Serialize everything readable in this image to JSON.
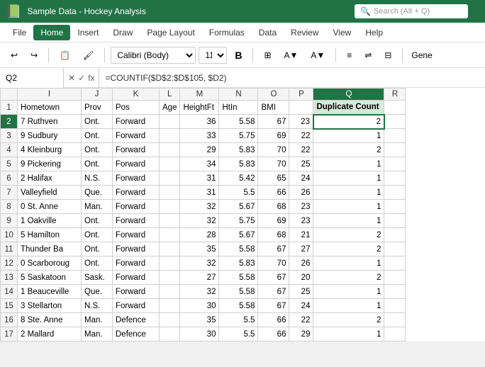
{
  "titleBar": {
    "icon": "📗",
    "title": "Sample Data - Hockey Analysis",
    "searchPlaceholder": "Search (Alt + Q)"
  },
  "menuBar": {
    "items": [
      "File",
      "Home",
      "Insert",
      "Draw",
      "Page Layout",
      "Formulas",
      "Data",
      "Review",
      "View",
      "Help"
    ],
    "activeIndex": 1
  },
  "toolbar": {
    "font": "Calibri (Body)",
    "fontSize": "11",
    "boldLabel": "B"
  },
  "formulaBar": {
    "nameBox": "Q2",
    "formula": "=COUNTIF($D$2:$D$105, $D2)"
  },
  "columns": {
    "headers": [
      "I",
      "J",
      "K",
      "L",
      "M",
      "N",
      "O",
      "P",
      "Q",
      "R"
    ],
    "widths": [
      90,
      50,
      70,
      30,
      60,
      60,
      50,
      40,
      90,
      30
    ]
  },
  "rowHeaders": [
    1,
    2,
    3,
    4,
    5,
    6,
    7,
    8,
    9,
    10,
    11,
    12,
    13,
    14,
    15,
    16,
    17
  ],
  "headerRow": {
    "cells": [
      "Hometown",
      "Prov",
      "Pos",
      "Age",
      "HeightFt",
      "HtIn",
      "BMI",
      "",
      "Duplicate Count",
      ""
    ]
  },
  "rows": [
    {
      "num": 2,
      "i": "7 Ruthven",
      "j": "Ont.",
      "k": "Forward",
      "l": "",
      "m": "36",
      "n": "5.58",
      "o": "67",
      "p": "23",
      "q": "2",
      "selected": true
    },
    {
      "num": 3,
      "i": "9 Sudbury",
      "j": "Ont.",
      "k": "Forward",
      "l": "",
      "m": "33",
      "n": "5.75",
      "o": "69",
      "p": "22",
      "q": "1",
      "selected": false
    },
    {
      "num": 4,
      "i": "4 Kleinburg",
      "j": "Ont.",
      "k": "Forward",
      "l": "",
      "m": "29",
      "n": "5.83",
      "o": "70",
      "p": "22",
      "q": "2",
      "selected": false
    },
    {
      "num": 5,
      "i": "9 Pickering",
      "j": "Ont.",
      "k": "Forward",
      "l": "",
      "m": "34",
      "n": "5.83",
      "o": "70",
      "p": "25",
      "q": "1",
      "selected": false
    },
    {
      "num": 6,
      "i": "2 Halifax",
      "j": "N.S.",
      "k": "Forward",
      "l": "",
      "m": "31",
      "n": "5.42",
      "o": "65",
      "p": "24",
      "q": "1",
      "selected": false
    },
    {
      "num": 7,
      "i": "Valleyfield",
      "j": "Que.",
      "k": "Forward",
      "l": "",
      "m": "31",
      "n": "5.5",
      "o": "66",
      "p": "26",
      "q": "1",
      "selected": false
    },
    {
      "num": 8,
      "i": "0 St. Anne",
      "j": "Man.",
      "k": "Forward",
      "l": "",
      "m": "32",
      "n": "5.67",
      "o": "68",
      "p": "23",
      "q": "1",
      "selected": false
    },
    {
      "num": 9,
      "i": "1 Oakville",
      "j": "Ont.",
      "k": "Forward",
      "l": "",
      "m": "32",
      "n": "5.75",
      "o": "69",
      "p": "23",
      "q": "1",
      "selected": false
    },
    {
      "num": 10,
      "i": "5 Hamilton",
      "j": "Ont.",
      "k": "Forward",
      "l": "",
      "m": "28",
      "n": "5.67",
      "o": "68",
      "p": "21",
      "q": "2",
      "selected": false
    },
    {
      "num": 11,
      "i": "Thunder Ba",
      "j": "Ont.",
      "k": "Forward",
      "l": "",
      "m": "35",
      "n": "5.58",
      "o": "67",
      "p": "27",
      "q": "2",
      "selected": false
    },
    {
      "num": 12,
      "i": "0 Scarboroug",
      "j": "Ont.",
      "k": "Forward",
      "l": "",
      "m": "32",
      "n": "5.83",
      "o": "70",
      "p": "26",
      "q": "1",
      "selected": false
    },
    {
      "num": 13,
      "i": "5 Saskatoon",
      "j": "Sask.",
      "k": "Forward",
      "l": "",
      "m": "27",
      "n": "5.58",
      "o": "67",
      "p": "20",
      "q": "2",
      "selected": false
    },
    {
      "num": 14,
      "i": "1 Beauceville",
      "j": "Que.",
      "k": "Forward",
      "l": "",
      "m": "32",
      "n": "5.58",
      "o": "67",
      "p": "25",
      "q": "1",
      "selected": false
    },
    {
      "num": 15,
      "i": "3 Stellarton",
      "j": "N.S.",
      "k": "Forward",
      "l": "",
      "m": "30",
      "n": "5.58",
      "o": "67",
      "p": "24",
      "q": "1",
      "selected": false
    },
    {
      "num": 16,
      "i": "8 Ste. Anne",
      "j": "Man.",
      "k": "Defence",
      "l": "",
      "m": "35",
      "n": "5.5",
      "o": "66",
      "p": "22",
      "q": "2",
      "selected": false
    },
    {
      "num": 17,
      "i": "2 Mallard",
      "j": "Man.",
      "k": "Defence",
      "l": "",
      "m": "30",
      "n": "5.5",
      "o": "66",
      "p": "29",
      "q": "1",
      "selected": false
    }
  ]
}
